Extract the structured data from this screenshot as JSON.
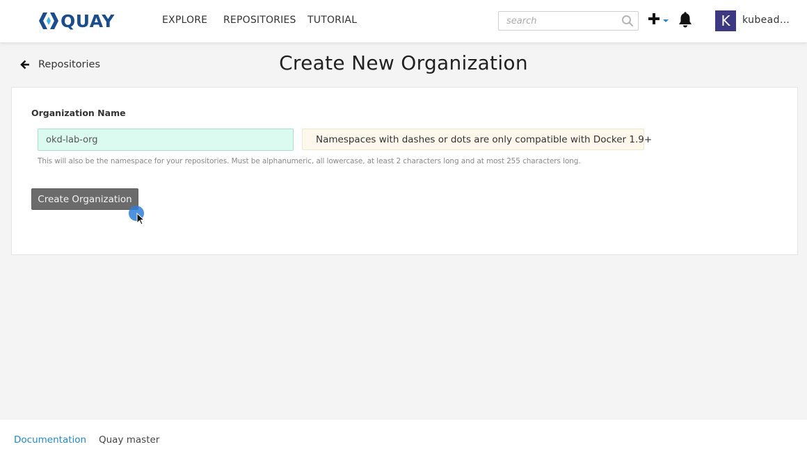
{
  "brand": {
    "name": "QUAY",
    "color": "#1b4d8c"
  },
  "nav": {
    "links": [
      {
        "label": "EXPLORE"
      },
      {
        "label": "REPOSITORIES"
      },
      {
        "label": "TUTORIAL"
      }
    ],
    "search": {
      "placeholder": "search",
      "value": ""
    },
    "user": {
      "avatar_letter": "K",
      "name": "kubead…",
      "avatar_color": "#3c3882"
    },
    "icons": [
      "search-icon",
      "plus-icon",
      "caret-down-icon",
      "bell-icon"
    ]
  },
  "page": {
    "back_label": "Repositories",
    "title": "Create New Organization"
  },
  "form": {
    "label": "Organization Name",
    "name_value": "okd-lab-org",
    "warning": "Namespaces with dashes or dots are only compatible with Docker 1.9+",
    "help": "This will also be the namespace for your repositories. Must be alphanumeric, all lowercase, at least 2 characters long and at most 255 characters long.",
    "submit_label": "Create Organization"
  },
  "footer": {
    "documentation": "Documentation",
    "version": "Quay master",
    "link_color": "#1e88d0"
  }
}
